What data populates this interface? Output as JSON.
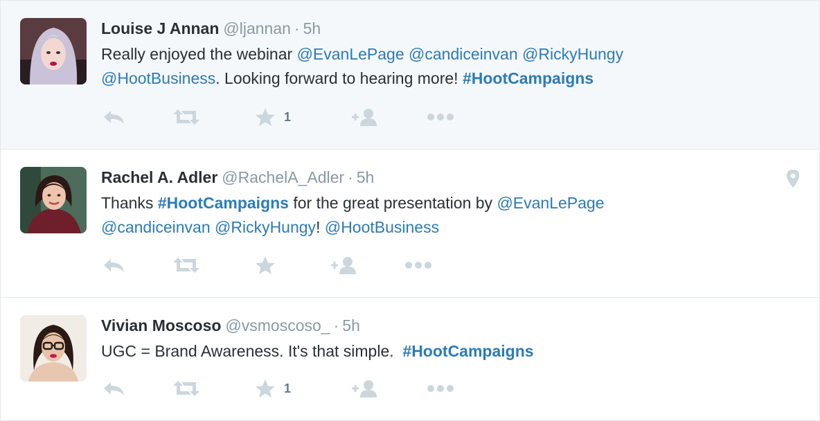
{
  "tweets": [
    {
      "fullname": "Louise J Annan",
      "username": "@ljannan",
      "separator": "·",
      "time": "5h",
      "text": {
        "t1": "Really enjoyed the webinar ",
        "m1": "@EvanLePage",
        "s1": " ",
        "m2": "@candiceinvan",
        "s2": " ",
        "m3": "@RickyHungy",
        "s3": " ",
        "m4": "@HootBusiness",
        "t2": ". Looking forward to hearing more! ",
        "h1": "#HootCampaigns"
      },
      "favorite_count": "1",
      "highlighted": true
    },
    {
      "fullname": "Rachel A. Adler",
      "username": "@RachelA_Adler",
      "separator": "·",
      "time": "5h",
      "text": {
        "t1": "Thanks ",
        "h1": "#HootCampaigns",
        "t2": " for the great presentation by ",
        "m1": "@EvanLePage",
        "s1": " ",
        "m2": "@candiceinvan",
        "s2": " ",
        "m3": "@RickyHungy",
        "t3": "! ",
        "m4": "@HootBusiness"
      },
      "favorite_count": "",
      "has_location": true
    },
    {
      "fullname": "Vivian Moscoso",
      "username": "@vsmoscoso_",
      "separator": "·",
      "time": "5h",
      "text": {
        "t1": "UGC = Brand Awareness. It's that simple.  ",
        "h1": "#HootCampaigns"
      },
      "favorite_count": "1"
    }
  ],
  "icons": {
    "reply": "reply-icon",
    "retweet": "retweet-icon",
    "favorite": "star-icon",
    "follow": "follow-icon",
    "more": "more-icon",
    "location": "location-pin-icon"
  },
  "colors": {
    "link": "#2b7bb9",
    "muted": "#8899a6",
    "icon": "#ccd6dd",
    "highlight_bg": "#f5f8fa",
    "border": "#e1e8ed"
  }
}
